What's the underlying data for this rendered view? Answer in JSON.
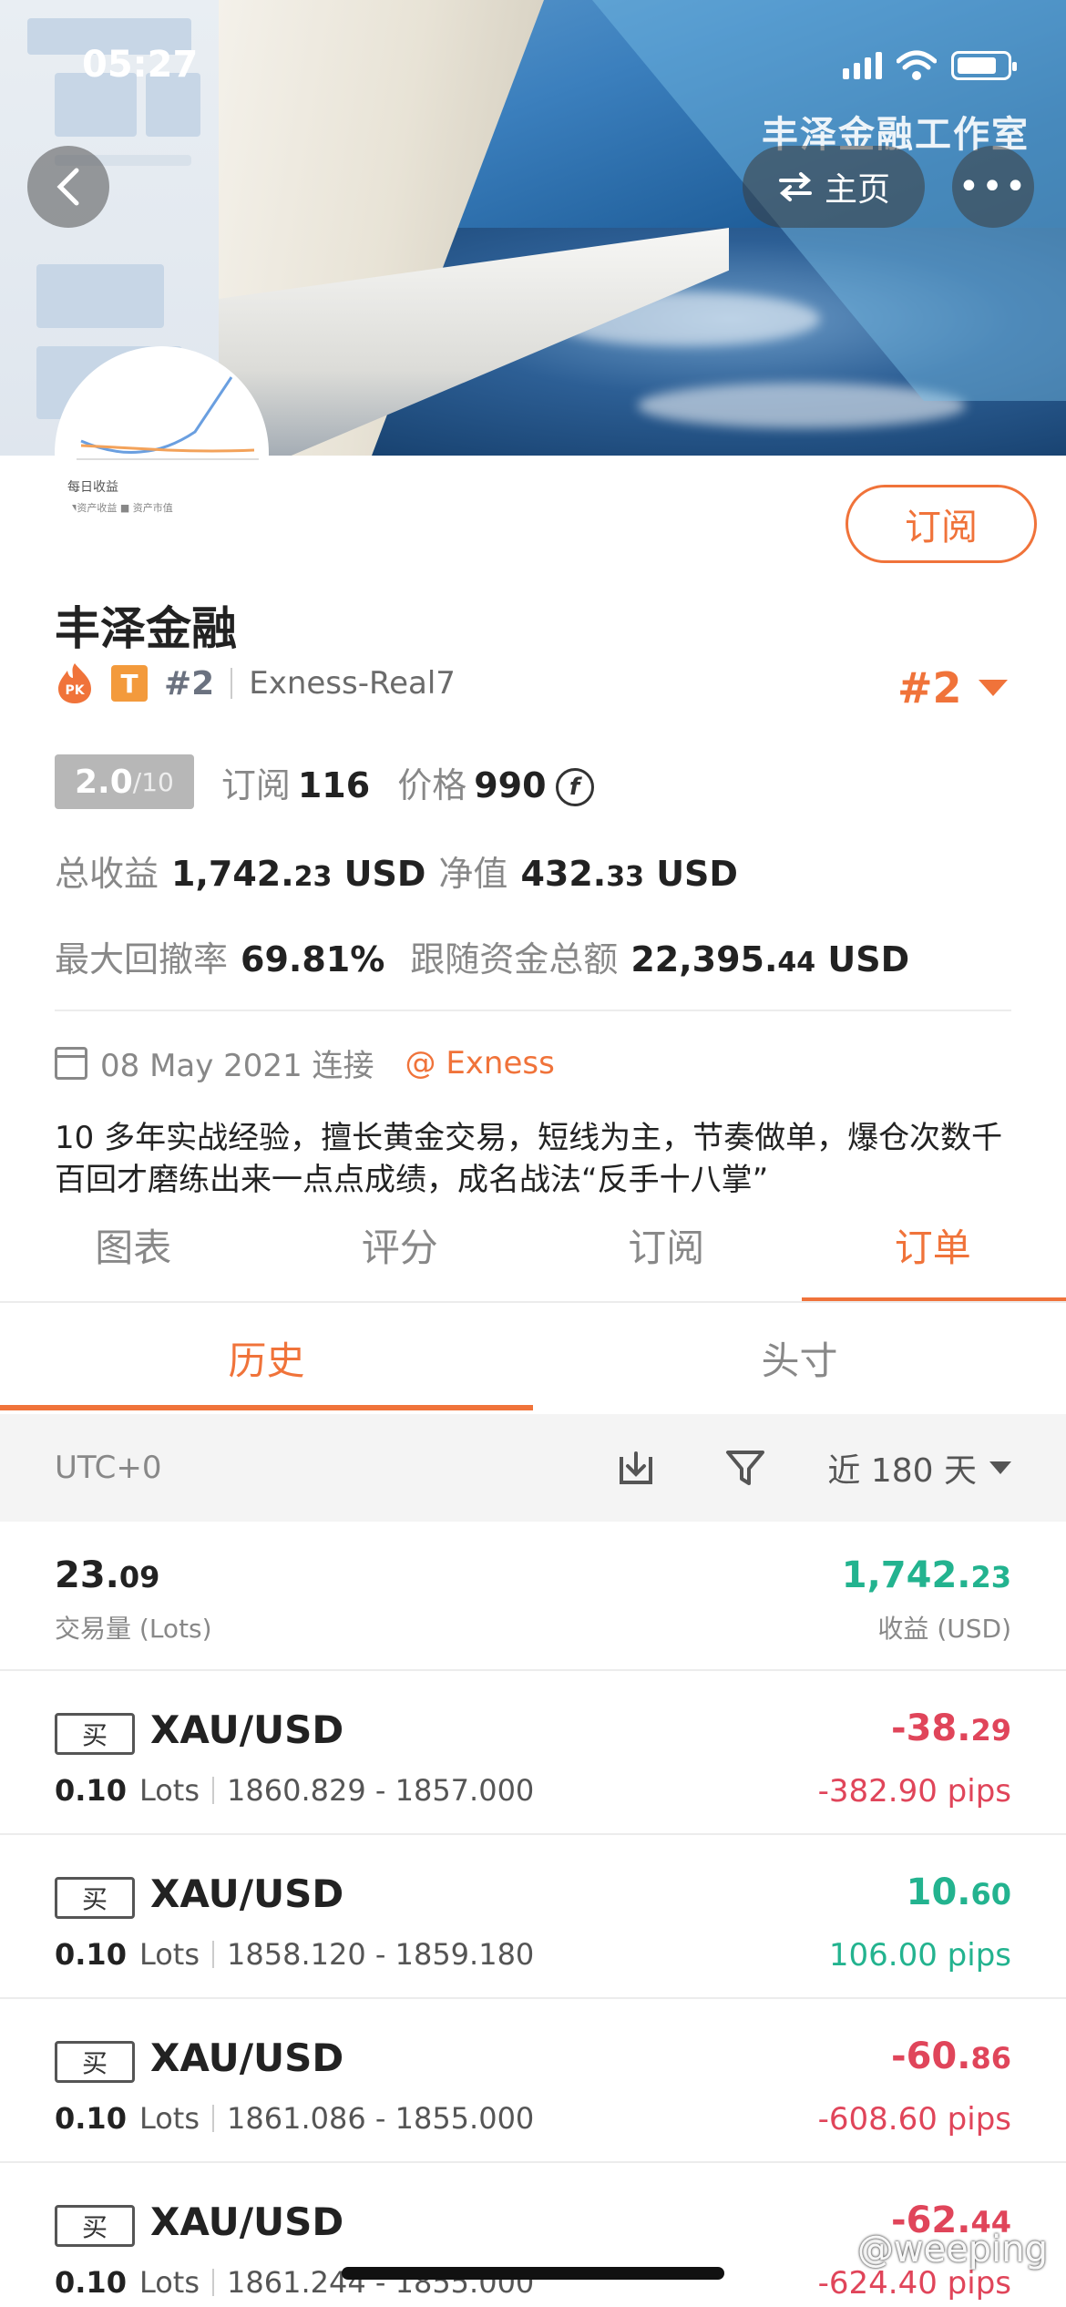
{
  "status_bar": {
    "time": "05:27"
  },
  "hero": {
    "studio_text": "丰泽金融工作室",
    "home_label": "主页",
    "more_label": "•••",
    "back_label": "‹"
  },
  "avatar": {
    "legend": "每日收益",
    "legend2": "■资产收益 ■ 资产市值"
  },
  "profile": {
    "subscribe_label": "订阅",
    "name": "丰泽金融",
    "pk_label": "PK",
    "tier_badge": "T",
    "rank_small": "#2",
    "server": "Exness-Real7",
    "rank_big": "#2",
    "score": "2.0",
    "score_max": "/10",
    "subs_label": "订阅",
    "subs_value": "116",
    "price_label": "价格",
    "price_value": "990",
    "coin_symbol": "f",
    "total_profit_label": "总收益",
    "total_profit_int": "1,742.",
    "total_profit_dec": "23",
    "total_profit_unit": "USD",
    "equity_label": "净值",
    "equity_int": "432.",
    "equity_dec": "33",
    "equity_unit": "USD",
    "max_dd_label": "最大回撤率",
    "max_dd_value": "69.81%",
    "follow_label": "跟随资金总额",
    "follow_int": "22,395.",
    "follow_dec": "44",
    "follow_unit": "USD",
    "connected_date": "08 May 2021 连接",
    "broker": "@ Exness",
    "bio": "10 多年实战经验，擅长黄金交易，短线为主，节奏做单，爆仓次数千百回才磨练出来一点点成绩，成名战法“反手十八掌”"
  },
  "tabs": [
    {
      "label": "图表",
      "active": false
    },
    {
      "label": "评分",
      "active": false
    },
    {
      "label": "订阅",
      "active": false
    },
    {
      "label": "订单",
      "active": true
    }
  ],
  "subtabs": [
    {
      "label": "历史",
      "active": true
    },
    {
      "label": "头寸",
      "active": false
    }
  ],
  "filter": {
    "timezone": "UTC+0",
    "range": "近 180 天"
  },
  "summary": {
    "volume_int": "23.",
    "volume_dec": "09",
    "volume_label": "交易量 (Lots)",
    "profit_int": "1,742.",
    "profit_dec": "23",
    "profit_label": "收益 (USD)"
  },
  "orders": [
    {
      "side": "买",
      "symbol": "XAU/USD",
      "lots": "0.10",
      "lots_unit": "Lots",
      "range": "1860.829 - 1857.000",
      "pnl_int": "-38.",
      "pnl_dec": "29",
      "pips": "-382.90 pips",
      "positive": false
    },
    {
      "side": "买",
      "symbol": "XAU/USD",
      "lots": "0.10",
      "lots_unit": "Lots",
      "range": "1858.120 - 1859.180",
      "pnl_int": "10.",
      "pnl_dec": "60",
      "pips": "106.00 pips",
      "positive": true
    },
    {
      "side": "买",
      "symbol": "XAU/USD",
      "lots": "0.10",
      "lots_unit": "Lots",
      "range": "1861.086 - 1855.000",
      "pnl_int": "-60.",
      "pnl_dec": "86",
      "pips": "-608.60 pips",
      "positive": false
    },
    {
      "side": "买",
      "symbol": "XAU/USD",
      "lots": "0.10",
      "lots_unit": "Lots",
      "range": "1861.244 - 1855.000",
      "pnl_int": "-62.",
      "pnl_dec": "44",
      "pips": "-624.40 pips",
      "positive": false
    }
  ],
  "watermark": "@weeping",
  "colors": {
    "accent": "#f0733a",
    "profit": "#23b38f",
    "loss": "#e0455a"
  }
}
